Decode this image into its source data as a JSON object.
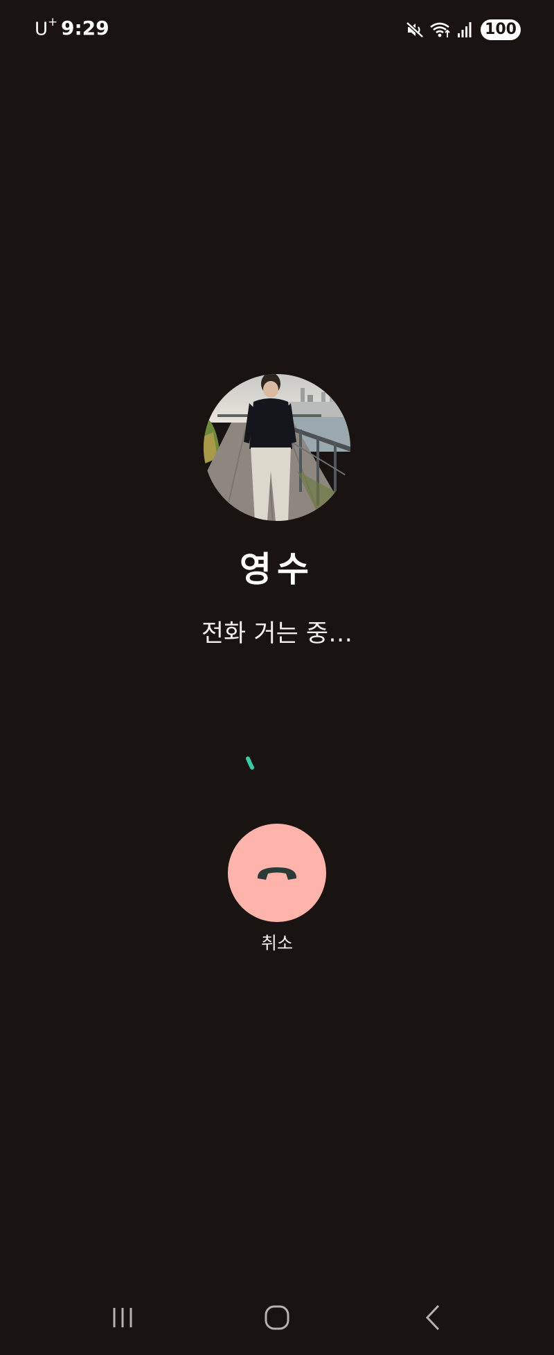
{
  "status_bar": {
    "carrier": "U",
    "carrier_sup": "+",
    "time": "9:29",
    "battery": "100",
    "icons": [
      "mute-icon",
      "wifi-icon",
      "signal-icon",
      "battery-icon"
    ]
  },
  "call": {
    "contact_name": "영수",
    "status": "전화 거는 중…",
    "end_label": "취소",
    "end_button_color": "#ffb4ab",
    "spinner_color": "#3ccaa6"
  },
  "nav": {
    "icons": [
      "recent-apps-icon",
      "home-icon",
      "back-icon"
    ]
  },
  "colors": {
    "background": "#191412",
    "text": "#ffffff"
  }
}
